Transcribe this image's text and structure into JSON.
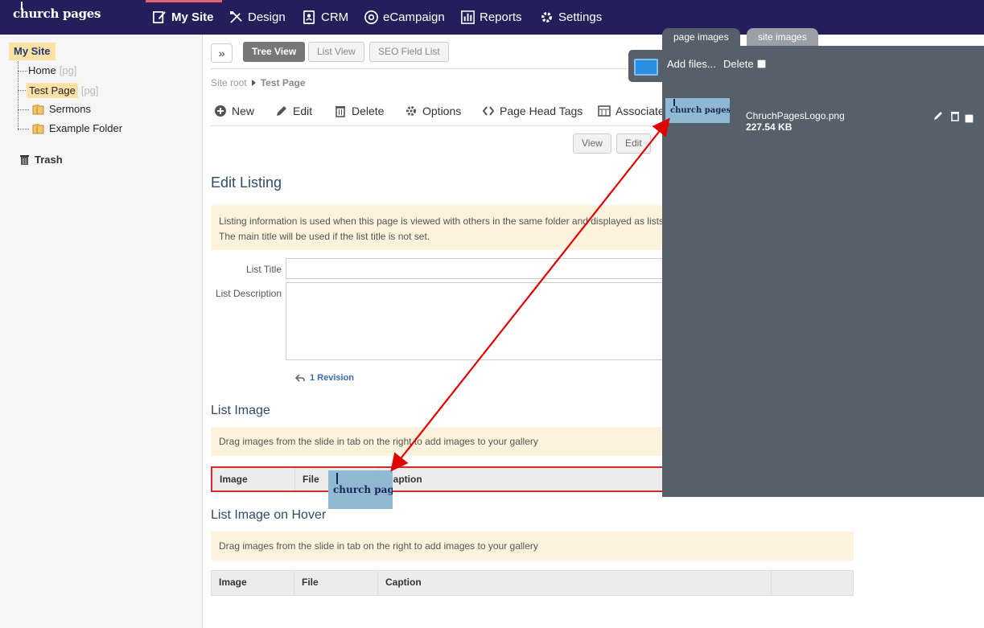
{
  "app": {
    "logo": "church pages"
  },
  "nav": {
    "items": [
      {
        "label": "My Site",
        "icon": "edit-page-icon"
      },
      {
        "label": "Design",
        "icon": "pencil-ruler-icon"
      },
      {
        "label": "CRM",
        "icon": "contacts-icon"
      },
      {
        "label": "eCampaign",
        "icon": "at-sign-icon"
      },
      {
        "label": "Reports",
        "icon": "bar-chart-icon"
      },
      {
        "label": "Settings",
        "icon": "gear-icon"
      }
    ],
    "active": "My Site",
    "active_color": "#e16272",
    "background": "#241f5a"
  },
  "sidebar": {
    "root": "My Site",
    "tree": [
      {
        "label": "Home",
        "tag": "[pg]"
      },
      {
        "label": "Test Page",
        "tag": "[pg]",
        "selected": true
      },
      {
        "label": "Sermons",
        "icon": "folder-icon"
      },
      {
        "label": "Example Folder",
        "icon": "folder-icon"
      }
    ],
    "trash": "Trash"
  },
  "toolbar": {
    "expand": "»",
    "views": [
      "Tree View",
      "List View",
      "SEO Field List"
    ],
    "active_view": "Tree View"
  },
  "breadcrumb": {
    "root": "Site root",
    "current": "Test Page"
  },
  "actions": [
    "New",
    "Edit",
    "Delete",
    "Options",
    "Page Head Tags",
    "Associate"
  ],
  "mode_buttons": [
    "View",
    "Edit"
  ],
  "edit_listing": {
    "title": "Edit Listing",
    "note_line1": "Listing information is used when this page is viewed with others in the same folder and displayed as lists",
    "note_line2": "The main title will be used if the list title is not set.",
    "list_title_label": "List Title",
    "list_title_value": "",
    "list_description_label": "List Description",
    "list_description_value": "",
    "revision": "1 Revision"
  },
  "list_image": {
    "title": "List Image",
    "note": "Drag images from the slide in tab on the right to add images to your gallery",
    "columns": [
      "Image",
      "File",
      "Caption"
    ]
  },
  "list_image_hover": {
    "title": "List Image on Hover",
    "note": "Drag images from the slide in tab on the right to add images to your gallery",
    "columns": [
      "Image",
      "File",
      "Caption"
    ]
  },
  "panel": {
    "tabs": [
      "page images",
      "site images"
    ],
    "active_tab": "page images",
    "add_files": "Add files...",
    "delete": "Delete",
    "file": {
      "name": "ChruchPagesLogo.png",
      "size": "227.54 KB",
      "thumb_text": "church pages"
    }
  },
  "drag": {
    "arrow_color": "#e00000"
  }
}
